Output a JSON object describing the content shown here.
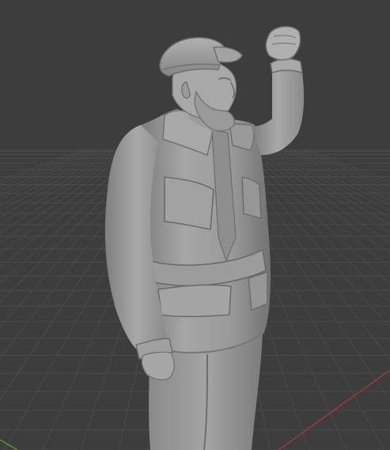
{
  "viewport": {
    "background_color": "#3d3d3d",
    "grid_color": "#4a4a4a",
    "x_axis_color": "#b03838",
    "y_axis_color": "#6a9a2c",
    "mesh_base_color": "#9c9c9c",
    "mesh_shadow_color": "#6e6e6e",
    "mesh_highlight_color": "#c4c4c4"
  }
}
